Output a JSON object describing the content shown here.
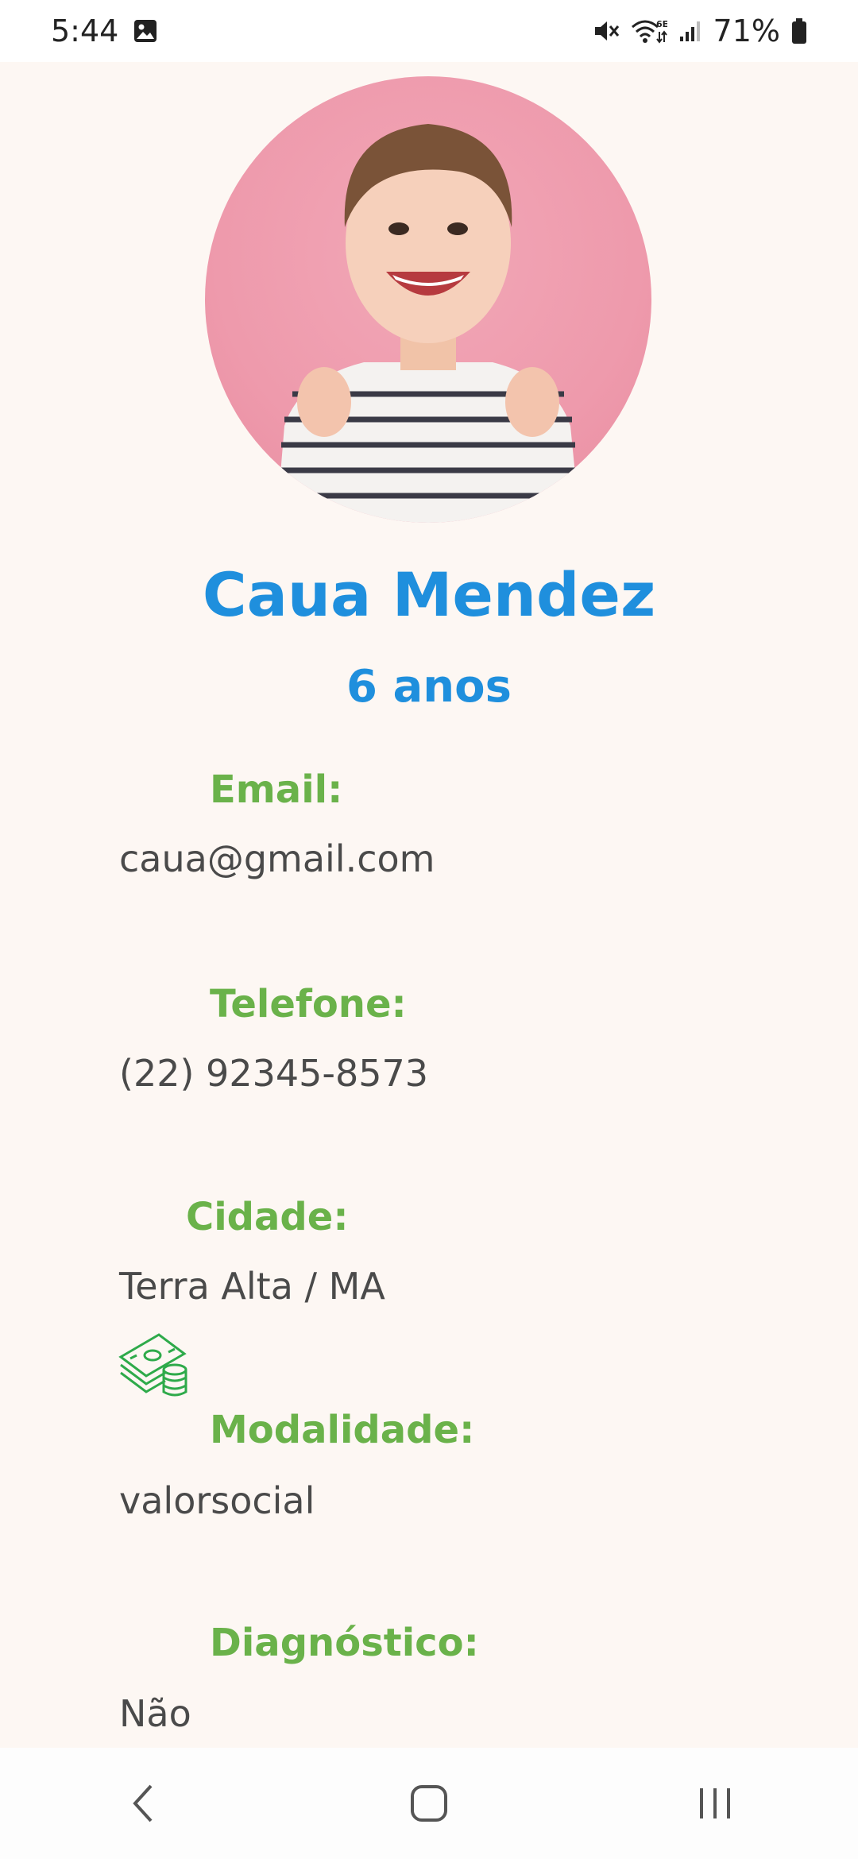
{
  "status_bar": {
    "time": "5:44",
    "battery": "71%",
    "icons": [
      "gallery-icon",
      "mute-icon",
      "wifi-6e-icon",
      "signal-icon",
      "battery-icon"
    ]
  },
  "profile": {
    "name": "Caua Mendez",
    "age": "6 anos",
    "photo": "child-photo"
  },
  "fields": {
    "email_label": "Email:",
    "email_value": "caua@gmail.com",
    "phone_label": "Telefone:",
    "phone_value": "(22) 92345-8573",
    "city_label": "Cidade:",
    "city_value": "Terra Alta / MA",
    "modality_label": "Modalidade:",
    "modality_value": "valorsocial",
    "modality_icon": "money-icon",
    "diagnosis_label": "Diagnóstico:",
    "diagnosis_value": "Não"
  },
  "nav": {
    "icons": [
      "back-icon",
      "home-icon",
      "recents-icon"
    ]
  },
  "colors": {
    "accent_blue": "#1f8fdd",
    "label_green": "#6ab24a",
    "background": "#fdf7f3",
    "avatar_bg": "#ee9aac"
  }
}
